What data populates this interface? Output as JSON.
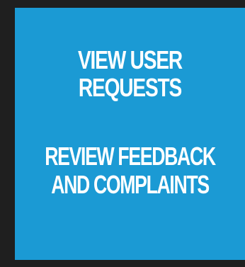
{
  "panel": {
    "background": "#1b9ad4",
    "text_color": "#ffffff",
    "frame_color": "#1f1f1f"
  },
  "actions": [
    {
      "lines": [
        "VIEW USER",
        "REQUESTS"
      ]
    },
    {
      "lines": [
        "REVIEW FEEDBACK",
        "AND COMPLAINTS"
      ]
    }
  ]
}
